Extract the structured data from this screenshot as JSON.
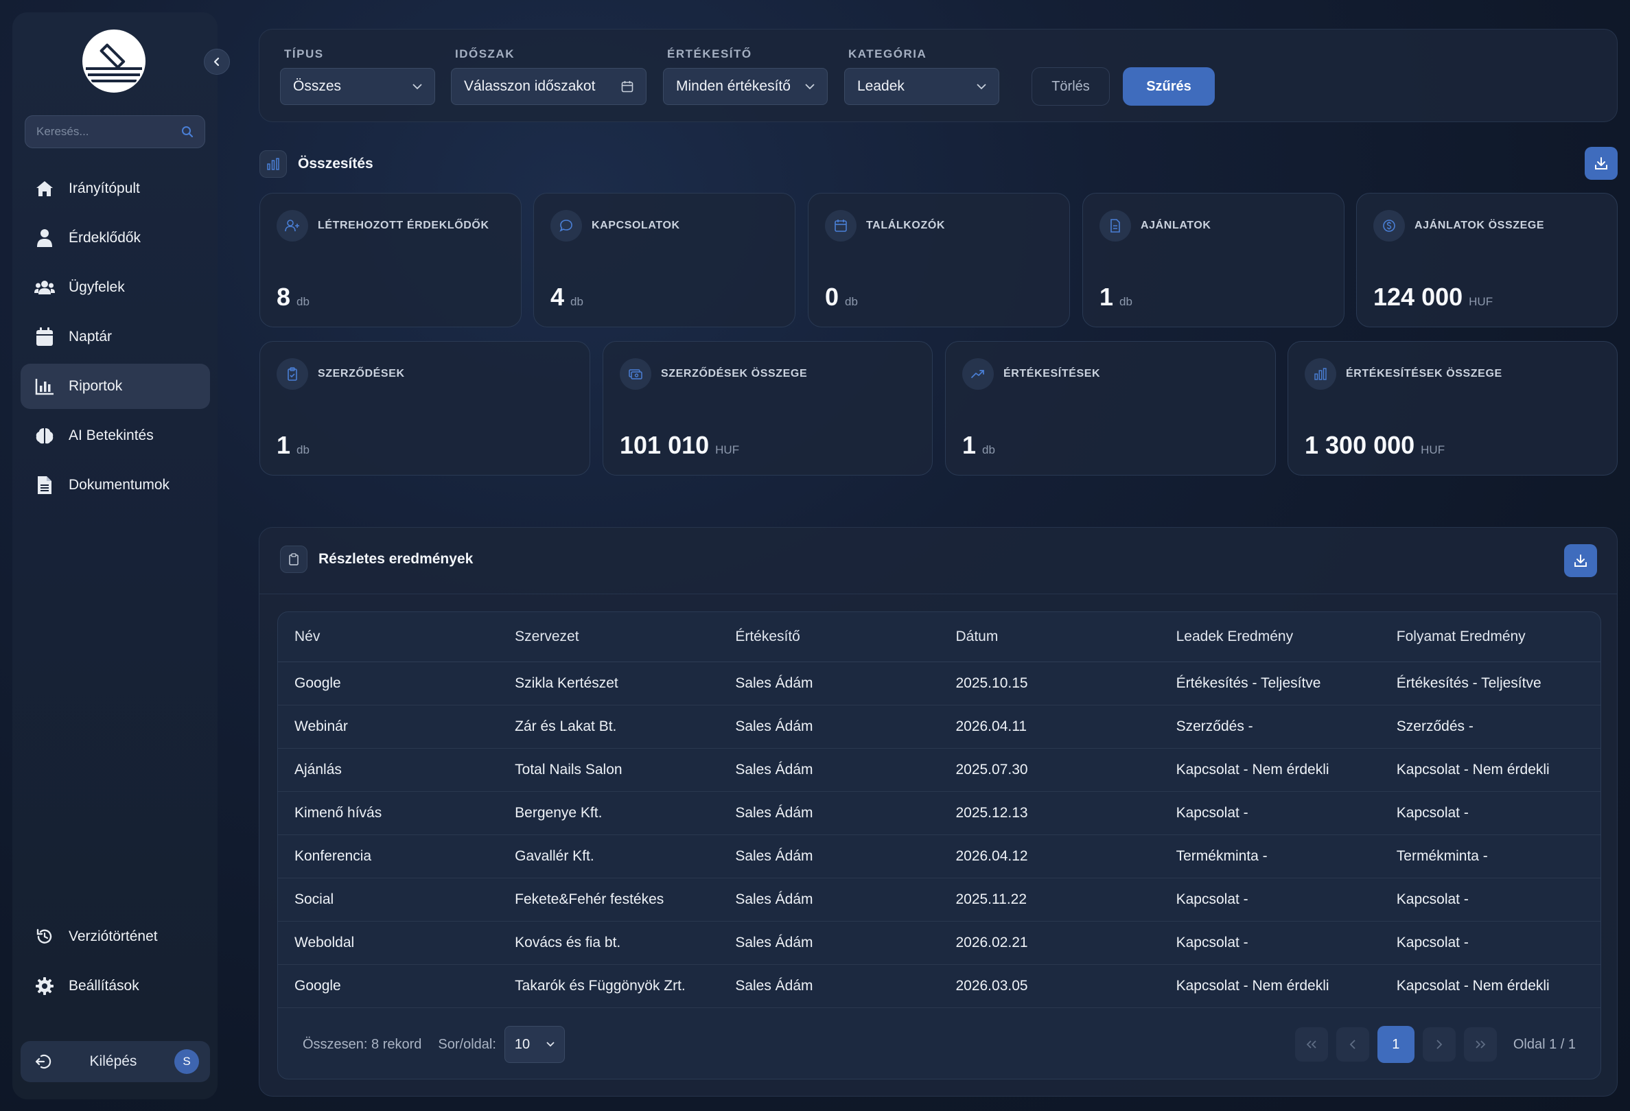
{
  "sidebar": {
    "search_placeholder": "Keresés...",
    "items": [
      {
        "label": "Irányítópult",
        "icon": "home-icon"
      },
      {
        "label": "Érdeklődők",
        "icon": "user-icon"
      },
      {
        "label": "Ügyfelek",
        "icon": "users-icon"
      },
      {
        "label": "Naptár",
        "icon": "calendar-icon"
      },
      {
        "label": "Riportok",
        "icon": "chart-icon",
        "active": true
      },
      {
        "label": "AI Betekintés",
        "icon": "brain-icon"
      },
      {
        "label": "Dokumentumok",
        "icon": "document-icon"
      }
    ],
    "bottom_items": [
      {
        "label": "Verziótörténet",
        "icon": "history-icon"
      },
      {
        "label": "Beállítások",
        "icon": "gear-icon"
      }
    ],
    "logout_label": "Kilépés",
    "avatar_initial": "S"
  },
  "filters": {
    "type": {
      "label": "TÍPUS",
      "value": "Összes"
    },
    "period": {
      "label": "IDŐSZAK",
      "value": "Válasszon időszakot"
    },
    "seller": {
      "label": "ÉRTÉKESÍTŐ",
      "value": "Minden értékesítő"
    },
    "category": {
      "label": "KATEGÓRIA",
      "value": "Leadek"
    },
    "clear_label": "Törlés",
    "filter_label": "Szűrés"
  },
  "summary": {
    "title": "Összesítés",
    "cards": [
      {
        "label": "LÉTREHOZOTT ÉRDEKLŐDŐK",
        "value": "8",
        "unit": "db",
        "icon": "user-plus-icon"
      },
      {
        "label": "KAPCSOLATOK",
        "value": "4",
        "unit": "db",
        "icon": "chat-icon"
      },
      {
        "label": "TALÁLKOZÓK",
        "value": "0",
        "unit": "db",
        "icon": "calendar-icon"
      },
      {
        "label": "AJÁNLATOK",
        "value": "1",
        "unit": "db",
        "icon": "document-icon"
      },
      {
        "label": "AJÁNLATOK ÖSSZEGE",
        "value": "124 000",
        "unit": "HUF",
        "icon": "coin-icon"
      },
      {
        "label": "SZERZŐDÉSEK",
        "value": "1",
        "unit": "db",
        "icon": "clipboard-check-icon"
      },
      {
        "label": "SZERZŐDÉSEK ÖSSZEGE",
        "value": "101 010",
        "unit": "HUF",
        "icon": "money-icon"
      },
      {
        "label": "ÉRTÉKESÍTÉSEK",
        "value": "1",
        "unit": "db",
        "icon": "trending-up-icon"
      },
      {
        "label": "ÉRTÉKESÍTÉSEK ÖSSZEGE",
        "value": "1 300 000",
        "unit": "HUF",
        "icon": "bar-chart-icon"
      }
    ]
  },
  "results": {
    "title": "Részletes eredmények",
    "columns": [
      "Név",
      "Szervezet",
      "Értékesítő",
      "Dátum",
      "Leadek Eredmény",
      "Folyamat Eredmény"
    ],
    "rows": [
      [
        "Google",
        "Szikla Kertészet",
        "Sales Ádám",
        "2025.10.15",
        "Értékesítés - Teljesítve",
        "Értékesítés - Teljesítve"
      ],
      [
        "Webinár",
        "Zár és Lakat Bt.",
        "Sales Ádám",
        "2026.04.11",
        "Szerződés -",
        "Szerződés -"
      ],
      [
        "Ajánlás",
        "Total Nails Salon",
        "Sales Ádám",
        "2025.07.30",
        "Kapcsolat - Nem érdekli",
        "Kapcsolat - Nem érdekli"
      ],
      [
        "Kimenő hívás",
        "Bergenye Kft.",
        "Sales Ádám",
        "2025.12.13",
        "Kapcsolat -",
        "Kapcsolat -"
      ],
      [
        "Konferencia",
        "Gavallér Kft.",
        "Sales Ádám",
        "2026.04.12",
        "Termékminta -",
        "Termékminta -"
      ],
      [
        "Social",
        "Fekete&Fehér festékes",
        "Sales Ádám",
        "2025.11.22",
        "Kapcsolat -",
        "Kapcsolat -"
      ],
      [
        "Weboldal",
        "Kovács és fia bt.",
        "Sales Ádám",
        "2026.02.21",
        "Kapcsolat -",
        "Kapcsolat -"
      ],
      [
        "Google",
        "Takarók és Függönyök Zrt.",
        "Sales Ádám",
        "2026.03.05",
        "Kapcsolat - Nem érdekli",
        "Kapcsolat - Nem érdekli"
      ]
    ],
    "pagination": {
      "total_label": "Összesen: 8 rekord",
      "per_page_label": "Sor/oldal:",
      "per_page_value": "10",
      "current_page": "1",
      "page_info": "Oldal 1 / 1"
    }
  },
  "colors": {
    "accent": "#3f6cbd",
    "background": "#141f35",
    "panel": "#1b263a"
  }
}
